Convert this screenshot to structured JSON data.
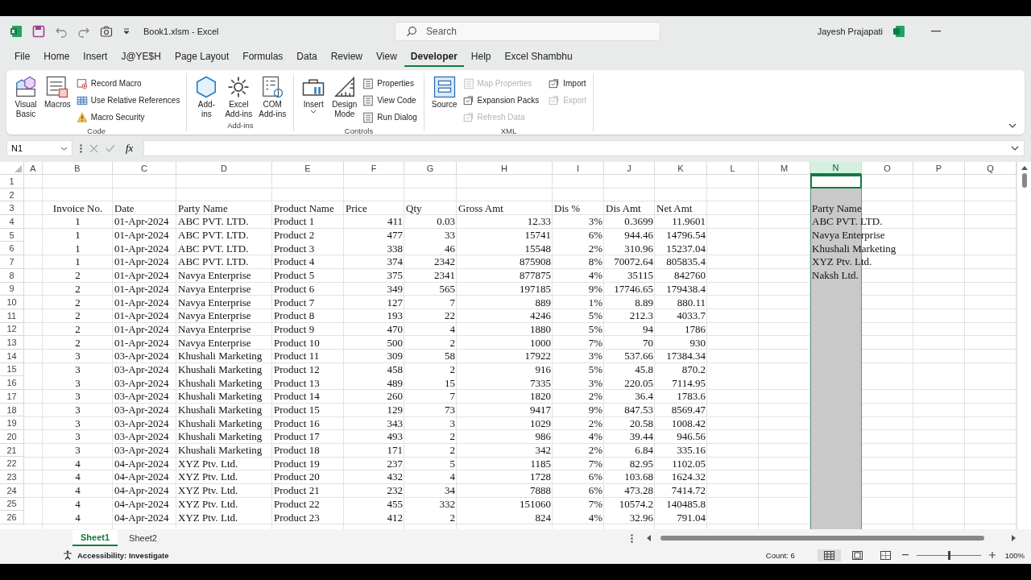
{
  "title_bar": {
    "title": "Book1.xlsm  -  Excel",
    "search": {
      "placeholder": "Search"
    },
    "user": "Jayesh Prajapati"
  },
  "tabs": [
    {
      "label": "File",
      "selected": false
    },
    {
      "label": "Home",
      "selected": false
    },
    {
      "label": "Insert",
      "selected": false
    },
    {
      "label": "J@YE$H",
      "selected": false
    },
    {
      "label": "Page Layout",
      "selected": false
    },
    {
      "label": "Formulas",
      "selected": false
    },
    {
      "label": "Data",
      "selected": false
    },
    {
      "label": "Review",
      "selected": false
    },
    {
      "label": "View",
      "selected": false
    },
    {
      "label": "Developer",
      "selected": true
    },
    {
      "label": "Help",
      "selected": false
    },
    {
      "label": "Excel Shambhu",
      "selected": false
    }
  ],
  "ribbon": {
    "groups": [
      {
        "label": "Code",
        "items": [
          {
            "kind": "large",
            "lines": [
              "Visual",
              "Basic"
            ],
            "disabled": false
          },
          {
            "kind": "large",
            "lines": [
              "Macros"
            ],
            "disabled": false
          },
          {
            "kind": "small",
            "lines": [
              "Record Macro"
            ],
            "disabled": false
          },
          {
            "kind": "small",
            "lines": [
              "Use Relative References"
            ],
            "disabled": false
          },
          {
            "kind": "small",
            "lines": [
              "Macro Security"
            ],
            "disabled": false
          }
        ]
      },
      {
        "label": "Add-ins",
        "items": [
          {
            "kind": "large",
            "lines": [
              "Add-",
              "ins"
            ],
            "disabled": false
          },
          {
            "kind": "large",
            "lines": [
              "Excel",
              "Add-ins"
            ],
            "disabled": false
          },
          {
            "kind": "large",
            "lines": [
              "COM",
              "Add-ins"
            ],
            "disabled": false
          }
        ]
      },
      {
        "label": "Controls",
        "items": [
          {
            "kind": "large",
            "lines": [
              "Insert"
            ],
            "dropdown": true,
            "disabled": false
          },
          {
            "kind": "large",
            "lines": [
              "Design",
              "Mode"
            ],
            "disabled": false
          },
          {
            "kind": "small",
            "lines": [
              "Properties"
            ],
            "disabled": false
          },
          {
            "kind": "small",
            "lines": [
              "View Code"
            ],
            "disabled": false
          },
          {
            "kind": "small",
            "lines": [
              "Run Dialog"
            ],
            "disabled": false
          }
        ]
      },
      {
        "label": "XML",
        "items": [
          {
            "kind": "large",
            "lines": [
              "Source"
            ],
            "disabled": false
          },
          {
            "kind": "small",
            "lines": [
              "Map Properties"
            ],
            "disabled": true
          },
          {
            "kind": "small",
            "lines": [
              "Expansion Packs"
            ],
            "disabled": false
          },
          {
            "kind": "small",
            "lines": [
              "Refresh Data"
            ],
            "disabled": true
          },
          {
            "kind": "small",
            "lines": [
              "Import"
            ],
            "disabled": false
          },
          {
            "kind": "small",
            "lines": [
              "Export"
            ],
            "disabled": true
          }
        ]
      }
    ]
  },
  "formula_bar": {
    "name_box": "N1",
    "function_label": "fx"
  },
  "sheet": {
    "columns": [
      {
        "letter": "A",
        "selected": false
      },
      {
        "letter": "B",
        "selected": false
      },
      {
        "letter": "C",
        "selected": false
      },
      {
        "letter": "D",
        "selected": false
      },
      {
        "letter": "E",
        "selected": false
      },
      {
        "letter": "F",
        "selected": false
      },
      {
        "letter": "G",
        "selected": false
      },
      {
        "letter": "H",
        "selected": false
      },
      {
        "letter": "I",
        "selected": false
      },
      {
        "letter": "J",
        "selected": false
      },
      {
        "letter": "K",
        "selected": false
      },
      {
        "letter": "L",
        "selected": false
      },
      {
        "letter": "M",
        "selected": false
      },
      {
        "letter": "N",
        "selected": true
      },
      {
        "letter": "O",
        "selected": false
      },
      {
        "letter": "P",
        "selected": false
      },
      {
        "letter": "Q",
        "selected": false
      }
    ],
    "rows": [
      {
        "number": "1",
        "kind": "blank",
        "cells": {}
      },
      {
        "number": "2",
        "kind": "blank",
        "cells": {}
      },
      {
        "number": "3",
        "kind": "header",
        "cells": {
          "B": "Invoice No.",
          "C": "Date",
          "D": "Party Name",
          "E": "Product Name",
          "F": "Price",
          "G": "Qty",
          "H": "Gross Amt",
          "I": "Dis %",
          "J": "Dis Amt",
          "K": "Net Amt",
          "N": "Party Name"
        }
      },
      {
        "number": "4",
        "kind": "data",
        "cells": {
          "B": "1",
          "C": "01-Apr-2024",
          "D": "ABC PVT. LTD.",
          "E": "Product 1",
          "F": "411",
          "G": "0.03",
          "H": "12.33",
          "I": "3%",
          "J": "0.3699",
          "K": "11.9601",
          "N": "ABC PVT. LTD."
        }
      },
      {
        "number": "5",
        "kind": "data",
        "cells": {
          "B": "1",
          "C": "01-Apr-2024",
          "D": "ABC PVT. LTD.",
          "E": "Product 2",
          "F": "477",
          "G": "33",
          "H": "15741",
          "I": "6%",
          "J": "944.46",
          "K": "14796.54",
          "N": "Navya Enterprise"
        }
      },
      {
        "number": "6",
        "kind": "data",
        "cells": {
          "B": "1",
          "C": "01-Apr-2024",
          "D": "ABC PVT. LTD.",
          "E": "Product 3",
          "F": "338",
          "G": "46",
          "H": "15548",
          "I": "2%",
          "J": "310.96",
          "K": "15237.04",
          "N": "Khushali Marketing"
        }
      },
      {
        "number": "7",
        "kind": "data",
        "cells": {
          "B": "1",
          "C": "01-Apr-2024",
          "D": "ABC PVT. LTD.",
          "E": "Product 4",
          "F": "374",
          "G": "2342",
          "H": "875908",
          "I": "8%",
          "J": "70072.64",
          "K": "805835.4",
          "N": "XYZ Ptv. Ltd."
        }
      },
      {
        "number": "8",
        "kind": "data",
        "cells": {
          "B": "2",
          "C": "01-Apr-2024",
          "D": "Navya Enterprise",
          "E": "Product 5",
          "F": "375",
          "G": "2341",
          "H": "877875",
          "I": "4%",
          "J": "35115",
          "K": "842760",
          "N": "Naksh Ltd."
        }
      },
      {
        "number": "9",
        "kind": "data",
        "cells": {
          "B": "2",
          "C": "01-Apr-2024",
          "D": "Navya Enterprise",
          "E": "Product 6",
          "F": "349",
          "G": "565",
          "H": "197185",
          "I": "9%",
          "J": "17746.65",
          "K": "179438.4"
        }
      },
      {
        "number": "10",
        "kind": "data",
        "cells": {
          "B": "2",
          "C": "01-Apr-2024",
          "D": "Navya Enterprise",
          "E": "Product 7",
          "F": "127",
          "G": "7",
          "H": "889",
          "I": "1%",
          "J": "8.89",
          "K": "880.11"
        }
      },
      {
        "number": "11",
        "kind": "data",
        "cells": {
          "B": "2",
          "C": "01-Apr-2024",
          "D": "Navya Enterprise",
          "E": "Product 8",
          "F": "193",
          "G": "22",
          "H": "4246",
          "I": "5%",
          "J": "212.3",
          "K": "4033.7"
        }
      },
      {
        "number": "12",
        "kind": "data",
        "cells": {
          "B": "2",
          "C": "01-Apr-2024",
          "D": "Navya Enterprise",
          "E": "Product 9",
          "F": "470",
          "G": "4",
          "H": "1880",
          "I": "5%",
          "J": "94",
          "K": "1786"
        }
      },
      {
        "number": "13",
        "kind": "data",
        "cells": {
          "B": "2",
          "C": "01-Apr-2024",
          "D": "Navya Enterprise",
          "E": "Product 10",
          "F": "500",
          "G": "2",
          "H": "1000",
          "I": "7%",
          "J": "70",
          "K": "930"
        }
      },
      {
        "number": "14",
        "kind": "data",
        "cells": {
          "B": "3",
          "C": "03-Apr-2024",
          "D": "Khushali Marketing",
          "E": "Product 11",
          "F": "309",
          "G": "58",
          "H": "17922",
          "I": "3%",
          "J": "537.66",
          "K": "17384.34"
        }
      },
      {
        "number": "15",
        "kind": "data",
        "cells": {
          "B": "3",
          "C": "03-Apr-2024",
          "D": "Khushali Marketing",
          "E": "Product 12",
          "F": "458",
          "G": "2",
          "H": "916",
          "I": "5%",
          "J": "45.8",
          "K": "870.2"
        }
      },
      {
        "number": "16",
        "kind": "data",
        "cells": {
          "B": "3",
          "C": "03-Apr-2024",
          "D": "Khushali Marketing",
          "E": "Product 13",
          "F": "489",
          "G": "15",
          "H": "7335",
          "I": "3%",
          "J": "220.05",
          "K": "7114.95"
        }
      },
      {
        "number": "17",
        "kind": "data",
        "cells": {
          "B": "3",
          "C": "03-Apr-2024",
          "D": "Khushali Marketing",
          "E": "Product 14",
          "F": "260",
          "G": "7",
          "H": "1820",
          "I": "2%",
          "J": "36.4",
          "K": "1783.6"
        }
      },
      {
        "number": "18",
        "kind": "data",
        "cells": {
          "B": "3",
          "C": "03-Apr-2024",
          "D": "Khushali Marketing",
          "E": "Product 15",
          "F": "129",
          "G": "73",
          "H": "9417",
          "I": "9%",
          "J": "847.53",
          "K": "8569.47"
        }
      },
      {
        "number": "19",
        "kind": "data",
        "cells": {
          "B": "3",
          "C": "03-Apr-2024",
          "D": "Khushali Marketing",
          "E": "Product 16",
          "F": "343",
          "G": "3",
          "H": "1029",
          "I": "2%",
          "J": "20.58",
          "K": "1008.42"
        }
      },
      {
        "number": "20",
        "kind": "data",
        "cells": {
          "B": "3",
          "C": "03-Apr-2024",
          "D": "Khushali Marketing",
          "E": "Product 17",
          "F": "493",
          "G": "2",
          "H": "986",
          "I": "4%",
          "J": "39.44",
          "K": "946.56"
        }
      },
      {
        "number": "21",
        "kind": "data",
        "cells": {
          "B": "3",
          "C": "03-Apr-2024",
          "D": "Khushali Marketing",
          "E": "Product 18",
          "F": "171",
          "G": "2",
          "H": "342",
          "I": "2%",
          "J": "6.84",
          "K": "335.16"
        }
      },
      {
        "number": "22",
        "kind": "data",
        "cells": {
          "B": "4",
          "C": "04-Apr-2024",
          "D": "XYZ Ptv. Ltd.",
          "E": "Product 19",
          "F": "237",
          "G": "5",
          "H": "1185",
          "I": "7%",
          "J": "82.95",
          "K": "1102.05"
        }
      },
      {
        "number": "23",
        "kind": "data",
        "cells": {
          "B": "4",
          "C": "04-Apr-2024",
          "D": "XYZ Ptv. Ltd.",
          "E": "Product 20",
          "F": "432",
          "G": "4",
          "H": "1728",
          "I": "6%",
          "J": "103.68",
          "K": "1624.32"
        }
      },
      {
        "number": "24",
        "kind": "data",
        "cells": {
          "B": "4",
          "C": "04-Apr-2024",
          "D": "XYZ Ptv. Ltd.",
          "E": "Product 21",
          "F": "232",
          "G": "34",
          "H": "7888",
          "I": "6%",
          "J": "473.28",
          "K": "7414.72"
        }
      },
      {
        "number": "25",
        "kind": "data",
        "cells": {
          "B": "4",
          "C": "04-Apr-2024",
          "D": "XYZ Ptv. Ltd.",
          "E": "Product 22",
          "F": "455",
          "G": "332",
          "H": "151060",
          "I": "7%",
          "J": "10574.2",
          "K": "140485.8"
        }
      },
      {
        "number": "26",
        "kind": "data",
        "cells": {
          "B": "4",
          "C": "04-Apr-2024",
          "D": "XYZ Ptv. Ltd.",
          "E": "Product 23",
          "F": "412",
          "G": "2",
          "H": "824",
          "I": "4%",
          "J": "32.96",
          "K": "791.04"
        }
      }
    ]
  },
  "sheet_tabs": [
    {
      "label": "Sheet1",
      "selected": true
    },
    {
      "label": "Sheet2",
      "selected": false
    }
  ],
  "status_bar": {
    "accessibility": "Accessibility: Investigate",
    "count": "Count: 6",
    "views": [
      {
        "selected": true
      },
      {
        "selected": false
      },
      {
        "selected": false
      }
    ],
    "zoom": {
      "level": 0.5,
      "reading": "100%"
    }
  }
}
